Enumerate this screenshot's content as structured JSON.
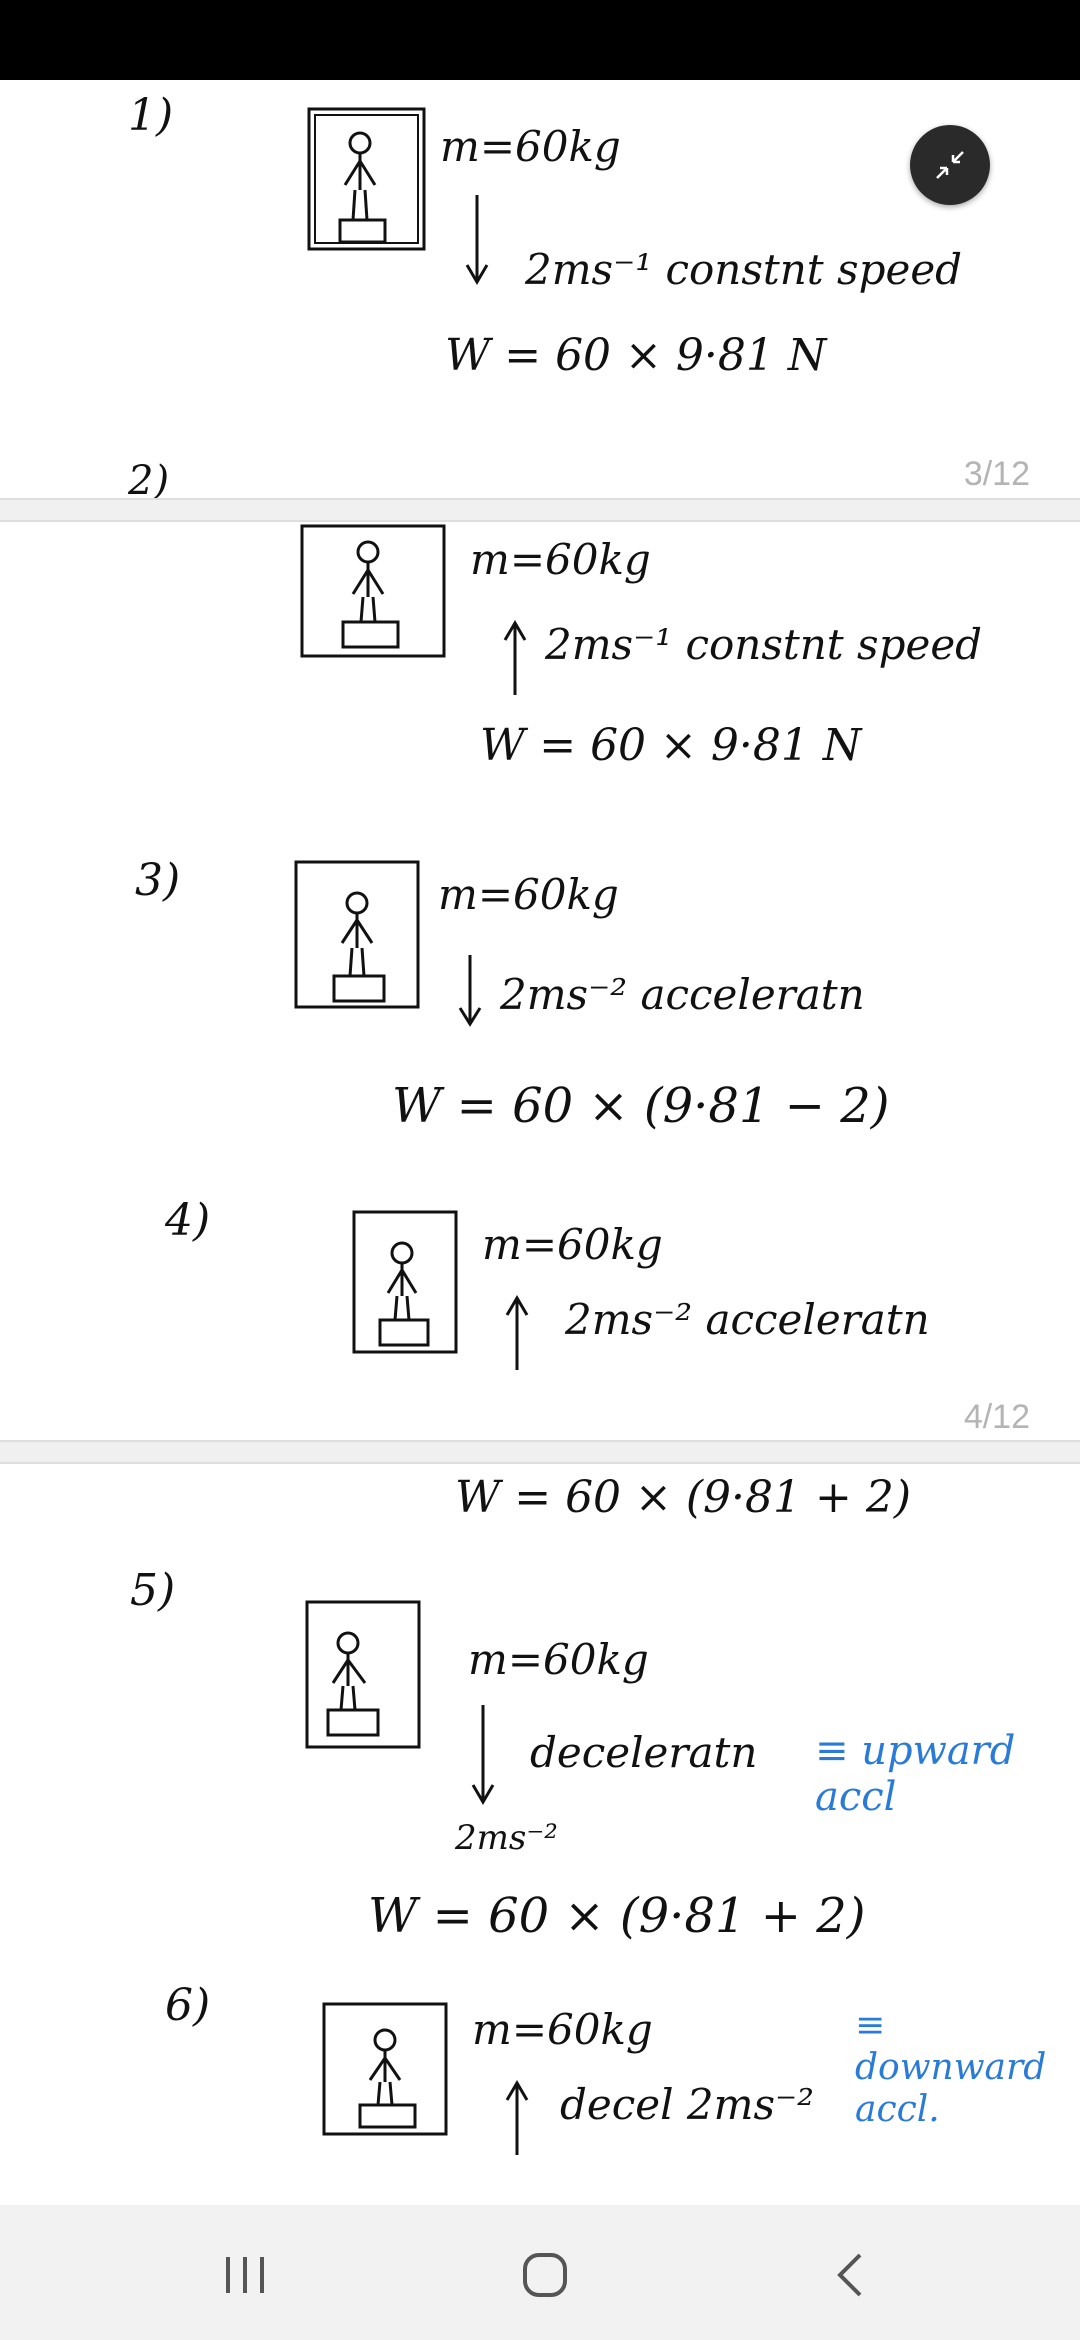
{
  "viewer": {
    "page_indicators": [
      "3/12",
      "4/12"
    ]
  },
  "problems": [
    {
      "num": "1)",
      "mass": "m=60kg",
      "motion": "2ms⁻¹  constnt speed",
      "weight": "W =  60 × 9·81 N"
    },
    {
      "num": "2)",
      "mass": "m=60kg",
      "motion": "2ms⁻¹  constnt speed",
      "weight": "W =  60 × 9·81 N"
    },
    {
      "num": "3)",
      "mass": "m=60kg",
      "motion": "2ms⁻² acceleratn",
      "weight": "W =  60 × (9·81 − 2)"
    },
    {
      "num": "4)",
      "mass": "m=60kg",
      "motion": "2ms⁻²  acceleratn",
      "weight": "W =  60 × (9·81 + 2)"
    },
    {
      "num": "5)",
      "mass": "m=60kg",
      "motion": "deceleratn",
      "accel_value": "2ms⁻²",
      "note": "≡ upward accl",
      "weight": "W =  60 × (9·81 + 2)"
    },
    {
      "num": "6)",
      "mass": "m=60kg",
      "motion": "decel   2ms⁻²",
      "note": "≡ downward accl."
    }
  ],
  "icons": {
    "collapse": "collapse-icon",
    "nav_recents": "recents-icon",
    "nav_home": "home-icon",
    "nav_back": "back-icon"
  },
  "colors": {
    "ink": "#111111",
    "blue_ink": "#2a7bd8",
    "status_bar": "#000000",
    "nav_bar": "#f2f2f2"
  }
}
